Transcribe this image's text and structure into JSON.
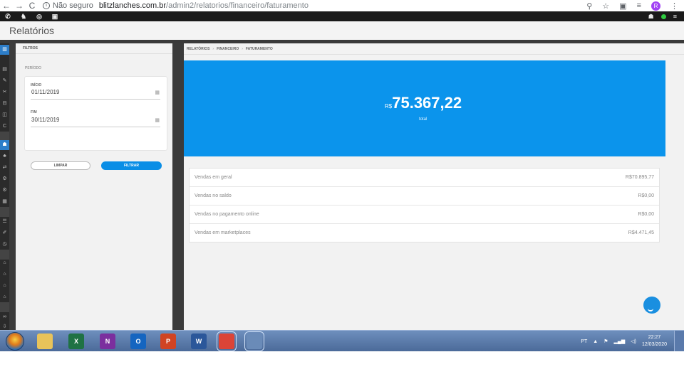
{
  "browser": {
    "back": "←",
    "forward": "→",
    "reload": "C",
    "secure_label": "Não seguro",
    "url_domain": "blitzlanches.com.br",
    "url_path": "/admin2/relatorios/financeiro/faturamento",
    "profile_initial": "R"
  },
  "page": {
    "title": "Relatórios"
  },
  "filters": {
    "header": "FILTROS",
    "period_label": "PERÍODO",
    "start_label": "INÍCIO",
    "start_value": "01/11/2019",
    "end_label": "FIM",
    "end_value": "30/11/2019",
    "clear_button": "LIMPAR",
    "filter_button": "FILTRAR"
  },
  "breadcrumb": {
    "root": "RELATÓRIOS",
    "level1": "FINANCEIRO",
    "level2": "FATURAMENTO"
  },
  "summary": {
    "currency": "R$",
    "total": "75.367,22",
    "caption": "total"
  },
  "sales": [
    {
      "label": "Vendas em geral",
      "value": "R$70.895,77"
    },
    {
      "label": "Vendas no saldo",
      "value": "R$0,00"
    },
    {
      "label": "Vendas no pagamento online",
      "value": "R$0,00"
    },
    {
      "label": "Vendas em marketplaces",
      "value": "R$4.471,45"
    }
  ],
  "taskbar": {
    "apps": [
      {
        "icon": "file-explorer-icon",
        "glyph": "",
        "color": "#e8c35a"
      },
      {
        "icon": "excel-icon",
        "glyph": "X",
        "color": "#1f7244"
      },
      {
        "icon": "onenote-icon",
        "glyph": "N",
        "color": "#7b2f9e"
      },
      {
        "icon": "outlook-icon",
        "glyph": "O",
        "color": "#1565c0"
      },
      {
        "icon": "powerpoint-icon",
        "glyph": "P",
        "color": "#d04423"
      },
      {
        "icon": "word-icon",
        "glyph": "W",
        "color": "#2b579a"
      },
      {
        "icon": "chrome-icon",
        "glyph": "",
        "color": "#db4437"
      },
      {
        "icon": "calculator-icon",
        "glyph": "",
        "color": "#6a8bb8"
      }
    ],
    "language": "PT",
    "time": "22:27",
    "date": "12/03/2020"
  },
  "colors": {
    "accent": "#0b94ec",
    "active_status": "#2ecc40"
  }
}
